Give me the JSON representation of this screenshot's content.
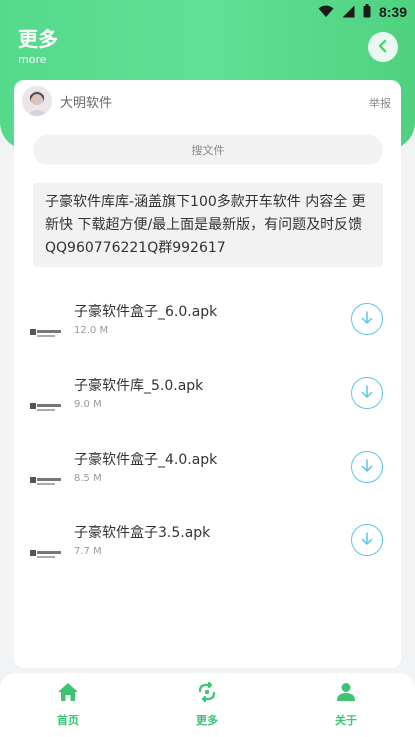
{
  "status_bar": {
    "time": "8:39",
    "icons": [
      "wifi-icon",
      "signal-icon",
      "battery-icon"
    ]
  },
  "header": {
    "title": "更多",
    "subtitle": "more",
    "back_icon": "chevron-left-icon"
  },
  "theme": {
    "accent": "#55d98b",
    "download_color": "#5bc5e4",
    "nav_color": "#3cc374"
  },
  "uploader": {
    "name": "大明软件",
    "report_label": "举报"
  },
  "search": {
    "placeholder": "搜文件"
  },
  "description": "子豪软件库库-涵盖旗下100多款开车软件 内容全 更新快 下载超方便/最上面是最新版，有问题及时反馈QQ960776221Q群992617",
  "files": [
    {
      "name": "子豪软件盒子_6.0.apk",
      "size": "12.0 M",
      "icon": "download-icon"
    },
    {
      "name": "子豪软件库_5.0.apk",
      "size": "9.0 M",
      "icon": "download-icon"
    },
    {
      "name": "子豪软件盒子_4.0.apk",
      "size": "8.5 M",
      "icon": "download-icon"
    },
    {
      "name": "子豪软件盒子3.5.apk",
      "size": "7.7 M",
      "icon": "download-icon"
    }
  ],
  "nav": [
    {
      "label": "首页",
      "icon": "home-icon"
    },
    {
      "label": "更多",
      "icon": "more-icon"
    },
    {
      "label": "关于",
      "icon": "user-icon"
    }
  ]
}
